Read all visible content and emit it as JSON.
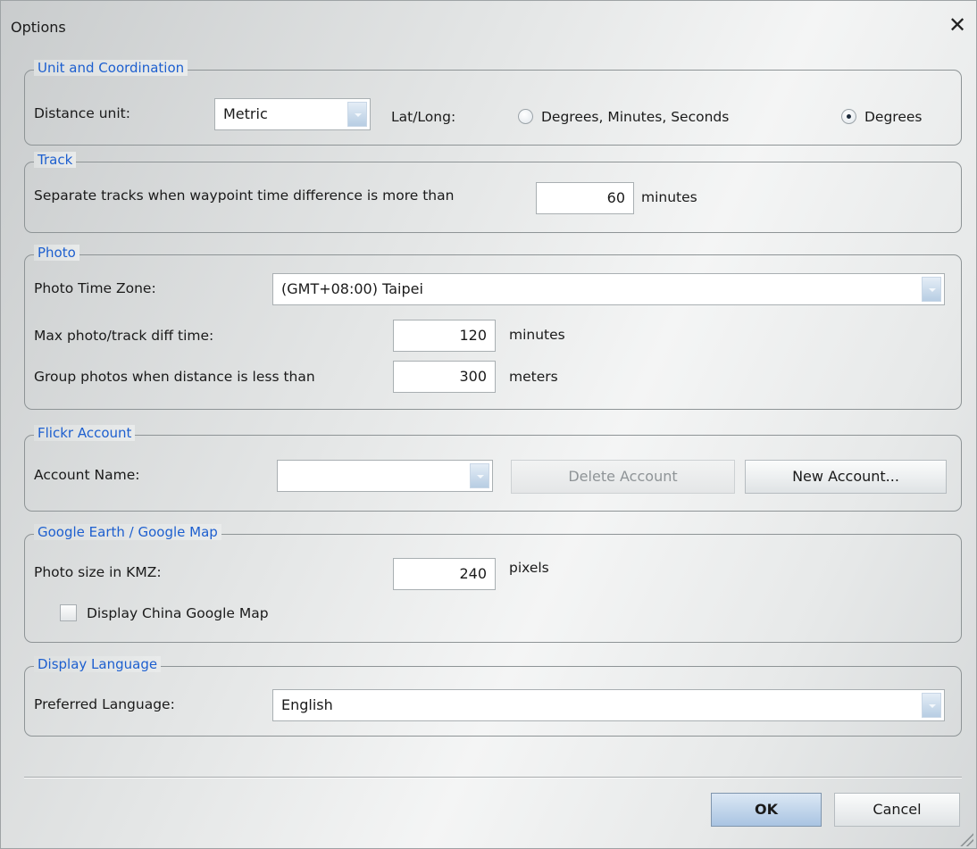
{
  "dialog": {
    "title": "Options",
    "close_glyph": "✕"
  },
  "unit": {
    "legend": "Unit and Coordination",
    "distance_label": "Distance unit:",
    "distance_value": "Metric",
    "latlong_label": "Lat/Long:",
    "options": [
      {
        "label": "Degrees, Minutes, Seconds",
        "selected": false
      },
      {
        "label": "Degrees",
        "selected": true
      }
    ]
  },
  "track": {
    "legend": "Track",
    "separate_label": "Separate tracks when waypoint time difference is more than",
    "separate_value": "60",
    "separate_unit": "minutes"
  },
  "photo": {
    "legend": "Photo",
    "timezone_label": "Photo Time Zone:",
    "timezone_value": "(GMT+08:00) Taipei",
    "maxdiff_label": "Max photo/track diff time:",
    "maxdiff_value": "120",
    "maxdiff_unit": "minutes",
    "group_label": "Group photos when distance is less than",
    "group_value": "300",
    "group_unit": "meters"
  },
  "flickr": {
    "legend": "Flickr Account",
    "account_label": "Account Name:",
    "account_value": "",
    "delete_label": "Delete Account",
    "new_label": "New Account..."
  },
  "google": {
    "legend": "Google Earth / Google Map",
    "photosize_label": "Photo size in KMZ:",
    "photosize_value": "240",
    "photosize_unit": "pixels",
    "china_label": "Display China Google Map",
    "china_checked": false
  },
  "language": {
    "legend": "Display Language",
    "preferred_label": "Preferred Language:",
    "preferred_value": "English"
  },
  "footer": {
    "ok_label": "OK",
    "cancel_label": "Cancel"
  }
}
